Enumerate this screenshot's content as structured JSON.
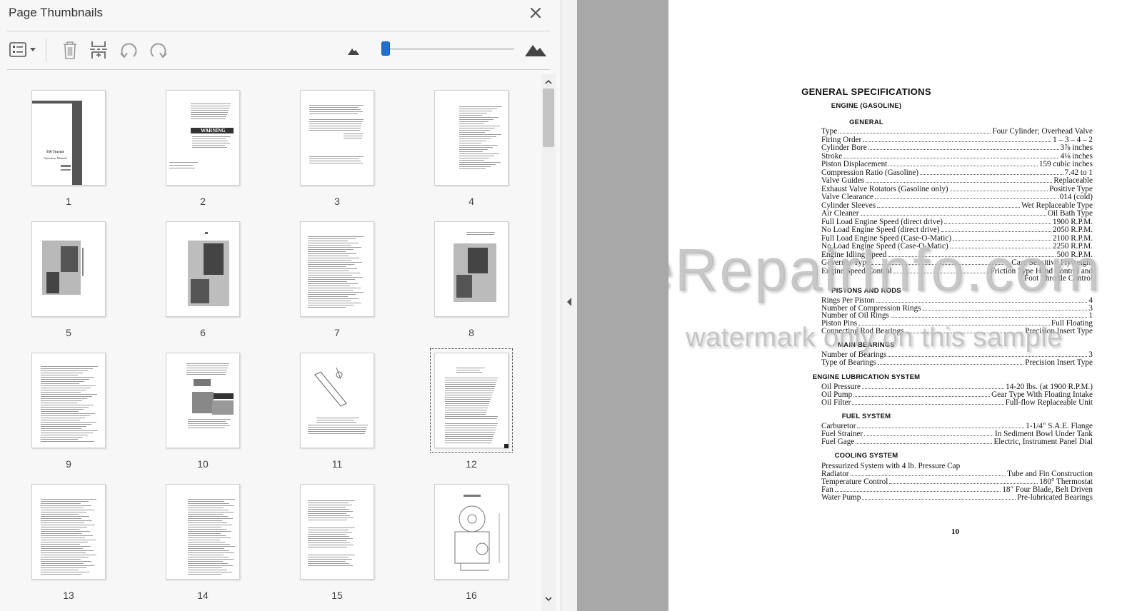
{
  "panel": {
    "title": "Page Thumbnails",
    "close_icon": "close-icon",
    "toolbar": {
      "options_icon": "thumbnail-options-icon",
      "delete_icon": "trash-icon",
      "insert_icon": "insert-pages-icon",
      "rotate_ccw_icon": "rotate-counterclockwise-icon",
      "rotate_cw_icon": "rotate-clockwise-icon",
      "zoom_out_icon": "small-mountain-icon",
      "zoom_in_icon": "large-mountain-icon",
      "zoom_level": 0.02
    },
    "selected_page": 12,
    "thumbnails": [
      {
        "page": "1"
      },
      {
        "page": "2"
      },
      {
        "page": "3"
      },
      {
        "page": "4"
      },
      {
        "page": "5"
      },
      {
        "page": "6"
      },
      {
        "page": "7"
      },
      {
        "page": "8"
      },
      {
        "page": "9"
      },
      {
        "page": "10"
      },
      {
        "page": "11"
      },
      {
        "page": "12"
      },
      {
        "page": "13"
      },
      {
        "page": "14"
      },
      {
        "page": "15"
      },
      {
        "page": "16"
      }
    ],
    "thumb_text": {
      "p1_title": "930 Tractor",
      "p1_sub": "Operators Manual",
      "p2_warning": "WARNING"
    }
  },
  "document": {
    "title": "GENERAL SPECIFICATIONS",
    "subtitle": "ENGINE (GASOLINE)",
    "sections": {
      "general": "GENERAL",
      "pistons": "PISTONS AND RODS",
      "main": "MAIN BEARINGS",
      "lube": "ENGINE LUBRICATION SYSTEM",
      "fuel": "FUEL SYSTEM",
      "cooling": "COOLING SYSTEM"
    },
    "general_specs": [
      {
        "label": "Type",
        "value": "Four Cylinder; Overhead Valve"
      },
      {
        "label": "Firing Order",
        "value": "1 – 3 – 4 – 2"
      },
      {
        "label": "Cylinder Bore",
        "value": "3⅞ inches"
      },
      {
        "label": "Stroke",
        "value": "4⅛ inches"
      },
      {
        "label": "Piston Displacement",
        "value": "159 cubic inches"
      },
      {
        "label": "Compression Ratio (Gasoline)",
        "value": "7.42 to 1"
      },
      {
        "label": "Valve Guides",
        "value": "Replaceable"
      },
      {
        "label": "Exhaust Valve Rotators (Gasoline only)",
        "value": "Positive Type"
      },
      {
        "label": "Valve Clearance",
        "value": ".014 (cold)"
      },
      {
        "label": "Cylinder Sleeves",
        "value": "Wet Replaceable Type"
      },
      {
        "label": "Air Cleaner",
        "value": "Oil Bath Type"
      },
      {
        "label": "Full Load Engine Speed (direct drive)",
        "value": "1900 R.P.M."
      },
      {
        "label": "No Load Engine Speed (direct drive)",
        "value": "2050 R.P.M."
      },
      {
        "label": "Full Load Engine Speed (Case-O-Matic)",
        "value": "2100 R.P.M."
      },
      {
        "label": "No Load Engine Speed (Case-O-Matic)",
        "value": "2250 R.P.M."
      },
      {
        "label": "Engine Idling Speed",
        "value": "500 R.P.M."
      },
      {
        "label": "Governor Type",
        "value": "Case Sensitive Flyweight"
      },
      {
        "label": "Engine Speed Control",
        "value": "Friction Type Hand Control and"
      }
    ],
    "engine_speed_cont": "Foot Throttle Control",
    "pistons_specs": [
      {
        "label": "Rings Per Piston",
        "value": "4"
      },
      {
        "label": "Number of Compression Rings",
        "value": "3"
      },
      {
        "label": "Number of Oil Rings",
        "value": "1"
      },
      {
        "label": "Piston Pins",
        "value": "Full Floating"
      },
      {
        "label": "Connecting Rod Bearings",
        "value": "Precision Insert Type"
      }
    ],
    "main_specs": [
      {
        "label": "Number of Bearings",
        "value": "3"
      },
      {
        "label": "Type of Bearings",
        "value": "Precision Insert Type"
      }
    ],
    "lube_specs": [
      {
        "label": "Oil Pressure",
        "value": "14-20 lbs. (at 1900 R.P.M.)"
      },
      {
        "label": "Oil Pump",
        "value": "Gear Type With Floating Intake"
      },
      {
        "label": "Oil Filter",
        "value": "Full-flow Replaceable Unit"
      }
    ],
    "fuel_specs": [
      {
        "label": "Carburetor",
        "value": "1-1/4\" S.A.E. Flange"
      },
      {
        "label": "Fuel Strainer",
        "value": "In Sediment Bowl Under Tank"
      },
      {
        "label": "Fuel Gage",
        "value": "Electric, Instrument Panel Dial"
      }
    ],
    "cooling_line": "Pressurized System with 4 lb. Pressure Cap",
    "cooling_specs": [
      {
        "label": "Radiator",
        "value": "Tube and Fin Construction"
      },
      {
        "label": "Temperature Control",
        "value": "180° Thermostat"
      },
      {
        "label": "Fan",
        "value": "18\" Four Blade, Belt Driven"
      },
      {
        "label": "Water Pump",
        "value": "Pre-lubricated Bearings"
      }
    ],
    "page_number": "10",
    "watermark_main": "eRepairInfo.com",
    "watermark_sub": "watermark only on this sample"
  }
}
